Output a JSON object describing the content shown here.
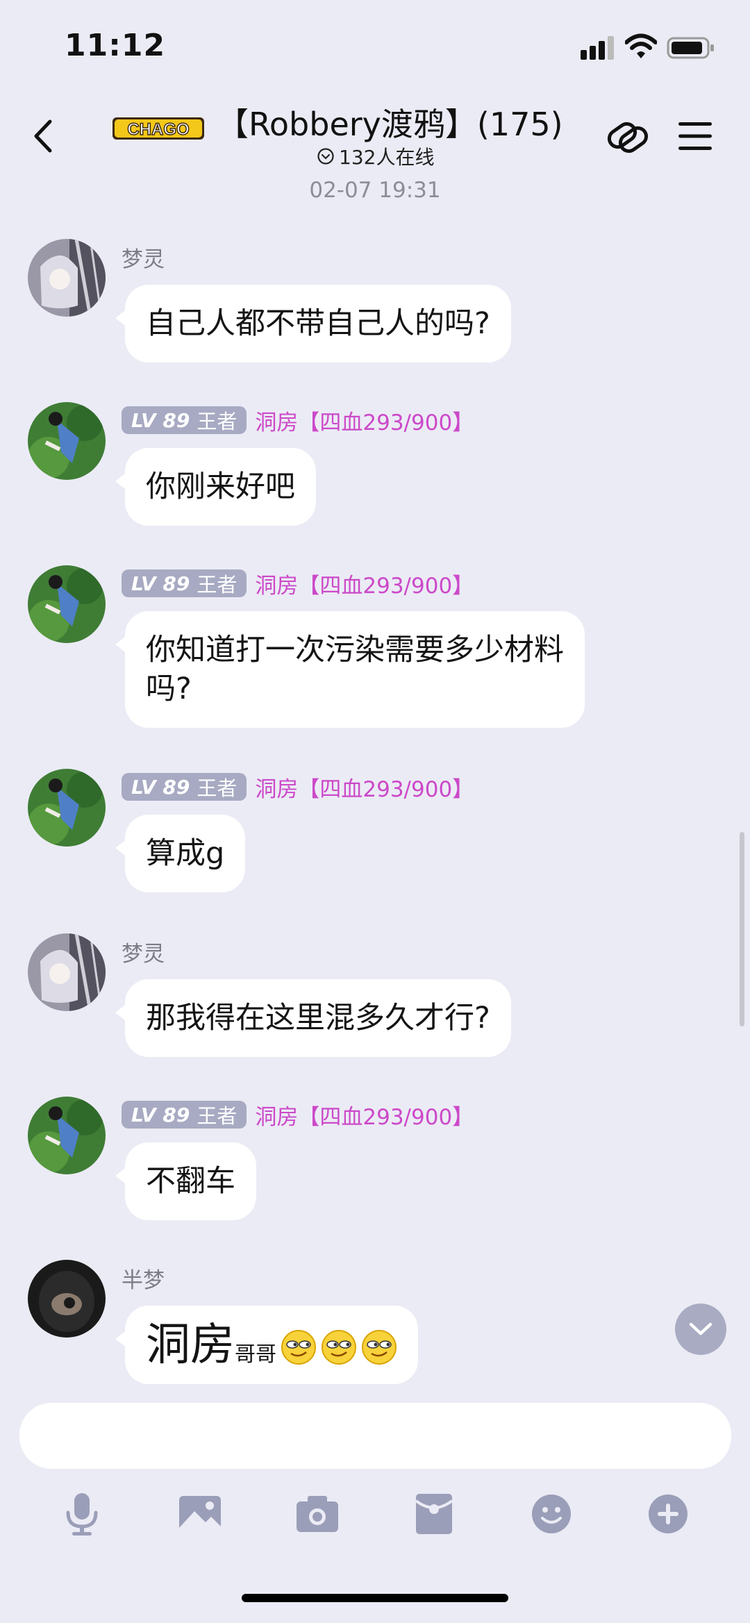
{
  "status_bar": {
    "time": "11:12"
  },
  "header": {
    "logo_text": "CHAGO",
    "title": "【Robbery渡鸦】(175)",
    "online_text": "132人在线"
  },
  "timestamp": "02-07 19:31",
  "messages": [
    {
      "nick": "梦灵",
      "text": "自己人都不带自己人的吗?"
    },
    {
      "level": "LV 89",
      "level_title": "王者",
      "member": "洞房【四血293/900】",
      "text": "你刚来好吧"
    },
    {
      "level": "LV 89",
      "level_title": "王者",
      "member": "洞房【四血293/900】",
      "text_line1": "你知道打一次污染需要多少材料",
      "text_line2": "吗?"
    },
    {
      "level": "LV 89",
      "level_title": "王者",
      "member": "洞房【四血293/900】",
      "text": "算成g"
    },
    {
      "nick": "梦灵",
      "text": "那我得在这里混多久才行?"
    },
    {
      "level": "LV 89",
      "level_title": "王者",
      "member": "洞房【四血293/900】",
      "text": "不翻车"
    },
    {
      "nick": "半梦",
      "text_big": "洞房",
      "text_small": "哥哥"
    }
  ],
  "icons": {
    "back": "chevron-left-icon",
    "link": "link-icon",
    "menu": "menu-icon",
    "toolbar": [
      "microphone-icon",
      "image-icon",
      "camera-icon",
      "red-packet-icon",
      "emoji-icon",
      "plus-icon"
    ]
  },
  "colors": {
    "member_name": "#cc49c9",
    "level_badge": "#a7aac2",
    "background": "#ebebf5"
  }
}
